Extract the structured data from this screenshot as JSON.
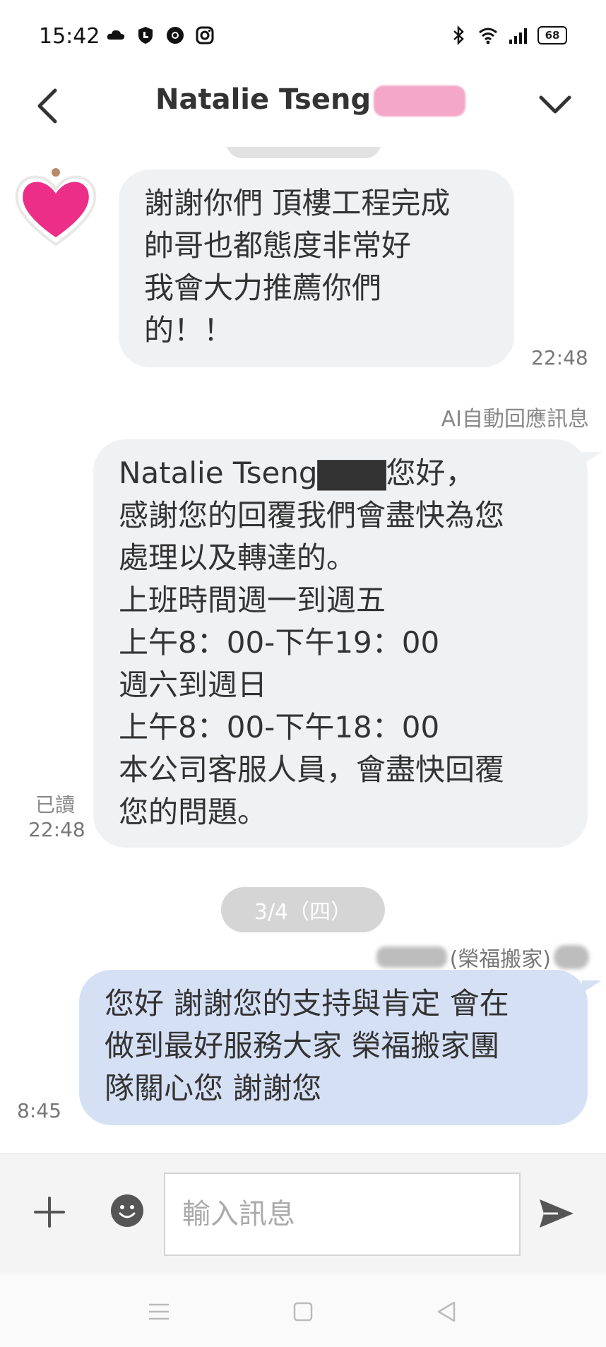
{
  "status_bar": {
    "time": "15:42",
    "battery": "68"
  },
  "header": {
    "title": "Natalie Tseng"
  },
  "messages": {
    "m1_text": "謝謝你們 頂樓工程完成\n帥哥也都態度非常好\n我會大力推薦你們\n的！！",
    "m1_time": "22:48",
    "ai_label": "AI自動回應訊息",
    "m2_text": "Natalie Tseng▇▇▇您好，\n感謝您的回覆我們會盡快為您\n處理以及轉達的。\n上班時間週一到週五\n上午8：00-下午19：00\n週六到週日\n上午8：00-下午18：00\n本公司客服人員，會盡快回覆\n您的問題。",
    "m2_read": "已讀",
    "m2_time": "22:48",
    "date_divider": "3/4（四）",
    "sender": "(榮福搬家)",
    "m3_text": "您好 謝謝您的支持與肯定 會在\n做到最好服務大家 榮福搬家團\n隊關心您 謝謝您",
    "m3_time": "8:45"
  },
  "input": {
    "placeholder": "輸入訊息"
  },
  "colors": {
    "incoming_bubble": "#f0f1f3",
    "outgoing_bubble": "#d6e0f5",
    "avatar_heart": "#ec2e86"
  },
  "icons": [
    "back-icon",
    "chevron-down-icon",
    "heart-icon",
    "plus-icon",
    "emoji-icon",
    "send-icon",
    "nav-menu-icon",
    "nav-home-icon",
    "nav-back-icon"
  ]
}
